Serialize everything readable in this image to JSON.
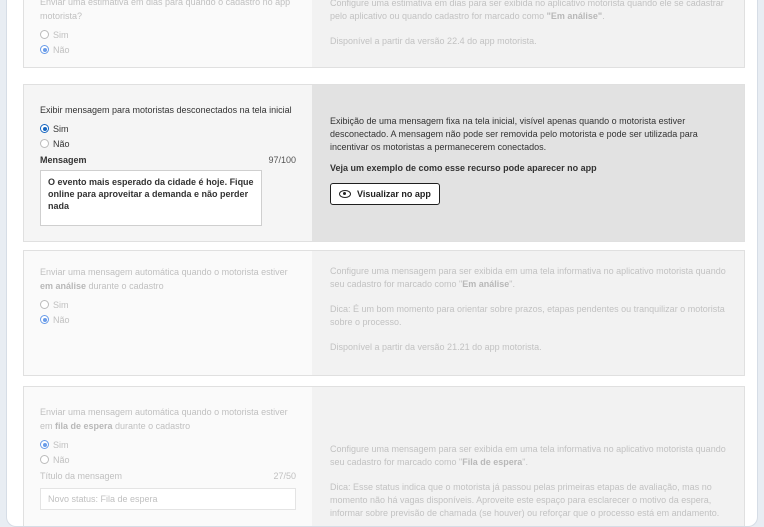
{
  "row1": {
    "question": "Enviar uma estimativa em dias para quando o cadastro no app motorista?",
    "options": [
      "Sim",
      "Não"
    ],
    "selected": "Não",
    "desc_line1": "Configure uma estimativa em dias para ser exibida no aplicativo motorista quando ele se cadastrar pelo aplicativo ou quando cadastro for marcado como ",
    "desc_bold": "\"Em análise\"",
    "desc_after": ".",
    "availability": "Disponível a partir da versão 22.4 do app motorista."
  },
  "row2": {
    "question": "Exibir mensagem para motoristas desconectados na tela inicial",
    "options": [
      "Sim",
      "Não"
    ],
    "selected": "Sim",
    "message_label": "Mensagem",
    "message_count": "97/100",
    "message_value": "O evento mais esperado da cidade é hoje. Fique online para aproveitar a demanda e não perder nada",
    "description": "Exibição de uma mensagem fixa na tela inicial, visível apenas quando o motorista estiver desconectado. A mensagem não pode ser removida pelo motorista e pode ser utilizada para incentivar os motoristas a permanecerem conectados.",
    "example_title": "Veja um exemplo de como esse recurso pode aparecer no app",
    "view_button": "Visualizar no app"
  },
  "row3": {
    "question_pre": "Enviar uma mensagem automática quando o motorista estiver ",
    "question_bold": "em análise",
    "question_post": " durante o cadastro",
    "options": [
      "Sim",
      "Não"
    ],
    "selected": "Não",
    "desc_pre": "Configure uma mensagem para ser exibida em uma tela informativa no aplicativo motorista quando seu cadastro for marcado como \"",
    "desc_bold": "Em análise",
    "desc_post": "\".",
    "tip": "Dica: É um bom momento para orientar sobre prazos, etapas pendentes ou tranquilizar o motorista sobre o processo.",
    "availability": "Disponível a partir da versão 21.21 do app motorista."
  },
  "row4": {
    "question_pre": "Enviar uma mensagem automática quando o motorista estiver em ",
    "question_bold": "fila de espera",
    "question_post": " durante o cadastro",
    "options": [
      "Sim",
      "Não"
    ],
    "selected": "Sim",
    "title_label": "Título da mensagem",
    "title_count": "27/50",
    "title_value": "Novo status: Fila de espera",
    "desc_pre": "Configure uma mensagem para ser exibida em uma tela informativa no aplicativo motorista quando seu cadastro for marcado como \"",
    "desc_bold": "Fila de espera",
    "desc_post": "\".",
    "tip": "Dica: Esse status indica que o motorista já passou pelas primeiras etapas de avaliação, mas no momento não há vagas disponíveis. Aproveite este espaço para esclarecer o motivo da espera, informar sobre previsão de chamada (se houver) ou reforçar que o processo está em andamento."
  }
}
